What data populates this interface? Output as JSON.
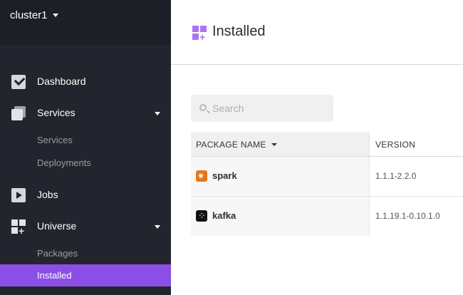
{
  "sidebar": {
    "cluster_name": "cluster1",
    "items": [
      {
        "label": "Dashboard",
        "icon": "dashboard-icon"
      },
      {
        "label": "Services",
        "icon": "services-icon",
        "expanded": true,
        "children": [
          "Services",
          "Deployments"
        ]
      },
      {
        "label": "Jobs",
        "icon": "jobs-icon"
      },
      {
        "label": "Universe",
        "icon": "universe-icon",
        "expanded": true,
        "children": [
          "Packages",
          "Installed"
        ],
        "active_child": "Installed"
      }
    ],
    "active_color": "#8b4fe8",
    "background_color": "#22252d"
  },
  "header": {
    "title": "Installed",
    "icon": "universe-icon",
    "icon_color": "#a976f0"
  },
  "search": {
    "placeholder": "Search",
    "value": ""
  },
  "table": {
    "columns": [
      "PACKAGE NAME",
      "VERSION"
    ],
    "sorted_by": "PACKAGE NAME",
    "rows": [
      {
        "name": "spark",
        "icon": "spark-icon",
        "version": "1.1.1-2.2.0"
      },
      {
        "name": "kafka",
        "icon": "kafka-icon",
        "version": "1.1.19.1-0.10.1.0"
      }
    ]
  }
}
